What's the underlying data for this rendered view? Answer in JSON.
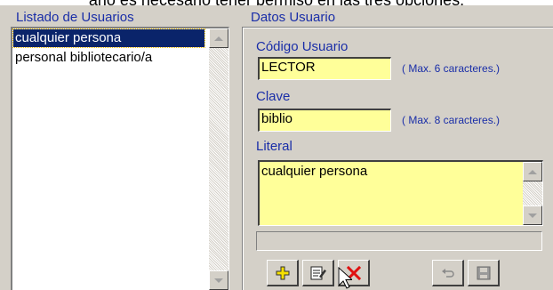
{
  "caption": "ario es necesario tener permiso en las tres opciones.",
  "user_list": {
    "title": "Listado de Usuarios",
    "items": [
      {
        "label": "cualquier persona",
        "selected": true
      },
      {
        "label": "personal bibliotecario/a",
        "selected": false
      }
    ]
  },
  "details": {
    "title": "Datos Usuario",
    "code_label": "Código Usuario",
    "code_value": "LECTOR",
    "code_hint": "( Max. 6 caracteres.)",
    "key_label": "Clave",
    "key_value": "biblio",
    "key_hint": "( Max. 8 caracteres.)",
    "literal_label": "Literal",
    "literal_value": "cualquier persona",
    "status_text": ""
  },
  "toolbar": {
    "buttons": [
      {
        "icon": "add-icon"
      },
      {
        "icon": "edit-icon"
      },
      {
        "icon": "delete-icon"
      },
      {
        "icon": "undo-icon"
      },
      {
        "icon": "save-icon"
      }
    ]
  },
  "colors": {
    "window_bg": "#d4d0c8",
    "label_blue": "#1a2ea8",
    "field_yellow": "#ffff99",
    "selection_bg": "#0a246a",
    "delete_red": "#e01010"
  }
}
